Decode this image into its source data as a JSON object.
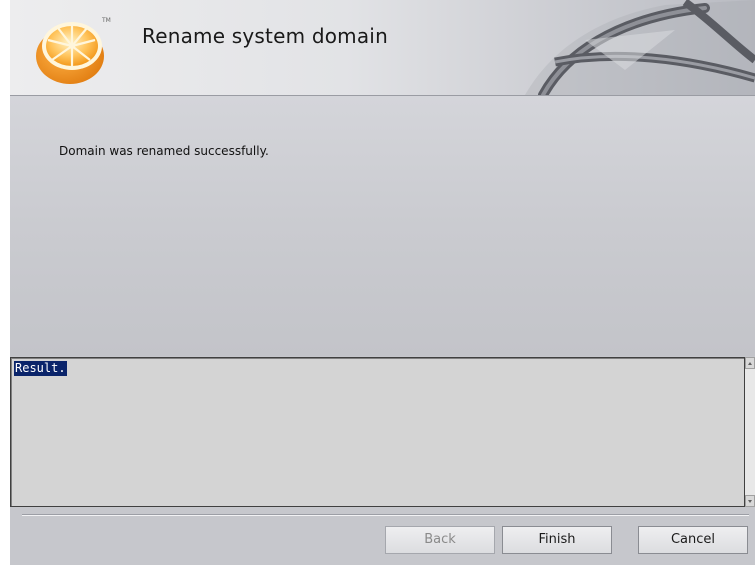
{
  "window": {
    "title": "Rename system domain",
    "logo_icon": "orange-slice-logo",
    "logo_mark": "TM"
  },
  "content": {
    "message": "Domain was renamed successfully."
  },
  "result_panel": {
    "text": "Result."
  },
  "buttons": {
    "back_label": "Back",
    "finish_label": "Finish",
    "cancel_label": "Cancel"
  },
  "colors": {
    "orange": "#f39a1e",
    "selection": "#0a246a"
  }
}
